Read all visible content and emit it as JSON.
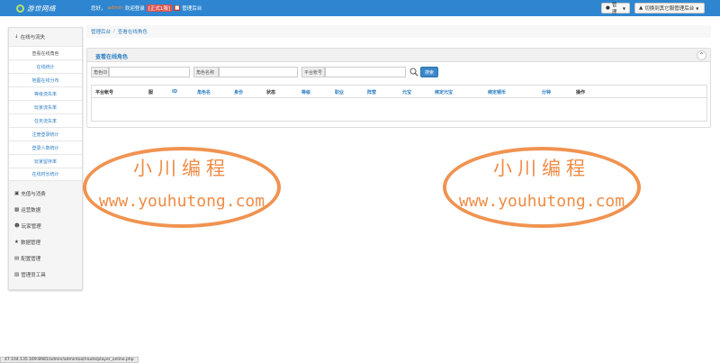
{
  "header": {
    "logo_text": "游世网络",
    "greeting_prefix": "您好，",
    "username": "admin",
    "greeting_mid": " 欢迎登录 ",
    "server_tag": "[正式1服]",
    "red_mark": "■",
    "greeting_suffix": " 管理后台",
    "manage_button": "管理",
    "switch_button": "切换到其它服管理后台"
  },
  "sidebar": {
    "section_online": "在线与流失",
    "online_items": [
      "查看在线角色",
      "在线统计",
      "地图在线分布",
      "等级流失率",
      "玩家流失率",
      "任务流失率",
      "注册登录统计",
      "登录人数统计",
      "玩家留存率",
      "在线时长统计"
    ],
    "sections": [
      "充值与消费",
      "运营数据",
      "玩家管理",
      "数据管理",
      "配置管理",
      "管理员工具"
    ]
  },
  "breadcrumb": {
    "root": "管理后台",
    "separator": "/",
    "current": "查看在线角色"
  },
  "panel": {
    "title": "查看在线角色",
    "collapse_symbol": "^"
  },
  "search": {
    "role_id_label": "角色ID",
    "role_name_label": "角色名称",
    "platform_account_label": "平台帐号",
    "role_id_value": "",
    "role_name_value": "",
    "platform_account_value": "",
    "search_button": "搜索"
  },
  "table": {
    "columns": [
      "平台帐号",
      "服",
      "ID",
      "角色名",
      "身份",
      "状态",
      "等级",
      "职业",
      "阵营",
      "元宝",
      "绑定元宝",
      "绑定铜币",
      "分钟",
      "操作"
    ],
    "link_columns": [
      2,
      3,
      4,
      6,
      7,
      8,
      9,
      10,
      11,
      12
    ]
  },
  "watermark": {
    "chinese": "小川编程",
    "url": "www.youhutong.com"
  },
  "status_url": "47.104.135.169:8981/admin/admintool/route/player_online.php",
  "colors": {
    "topbar": "#2f86d0",
    "link": "#2f7fc3",
    "watermark": "#ed8032",
    "search_button": "#3a87c8"
  }
}
